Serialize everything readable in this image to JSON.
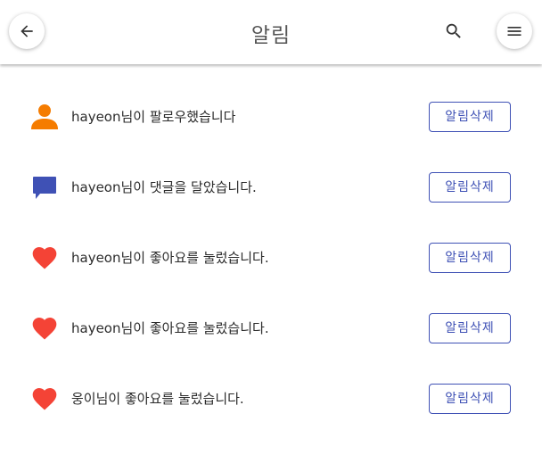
{
  "header": {
    "title": "알림"
  },
  "colors": {
    "accent": "#3f51b5",
    "follow_icon": "#f57c00",
    "comment_icon": "#3f51b5",
    "like_icon": "#f44336"
  },
  "notifications": [
    {
      "icon": "person-icon",
      "text": "hayeon님이 팔로우했습니다",
      "delete_label": "알림삭제"
    },
    {
      "icon": "comment-icon",
      "text": "hayeon님이 댓글을 달았습니다.",
      "delete_label": "알림삭제"
    },
    {
      "icon": "heart-icon",
      "text": "hayeon님이 좋아요를 눌렀습니다.",
      "delete_label": "알림삭제"
    },
    {
      "icon": "heart-icon",
      "text": "hayeon님이 좋아요를 눌렀습니다.",
      "delete_label": "알림삭제"
    },
    {
      "icon": "heart-icon",
      "text": "웅이님이 좋아요를 눌렀습니다.",
      "delete_label": "알림삭제"
    }
  ]
}
